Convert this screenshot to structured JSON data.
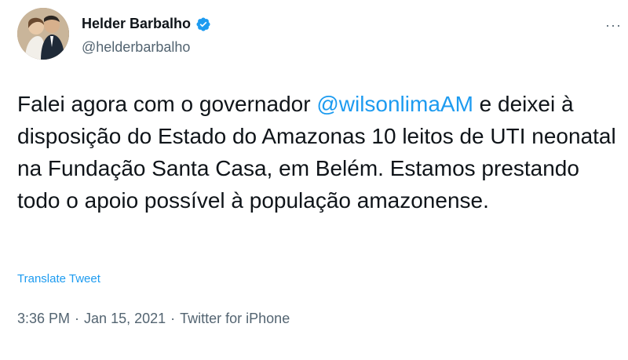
{
  "user": {
    "display_name": "Helder Barbalho",
    "handle": "@helderbarbalho",
    "verified_icon": "verified-badge-icon"
  },
  "more_icon": "more-options-icon",
  "more_glyph": "···",
  "tweet": {
    "text_before": "Falei agora com o governador ",
    "mention": "@wilsonlimaAM",
    "text_after": " e deixei à disposição do Estado do Amazonas 10 leitos de UTI neonatal na Fundação Santa Casa, em Belém. Estamos prestando todo o apoio possível à população amazonense.",
    "translate_label": "Translate Tweet",
    "time": "3:36 PM",
    "date": "Jan 15, 2021",
    "source": "Twitter for iPhone",
    "separator": "·"
  },
  "colors": {
    "link": "#1d9bf0",
    "secondary_text": "#536471",
    "primary_text": "#0f1419"
  }
}
